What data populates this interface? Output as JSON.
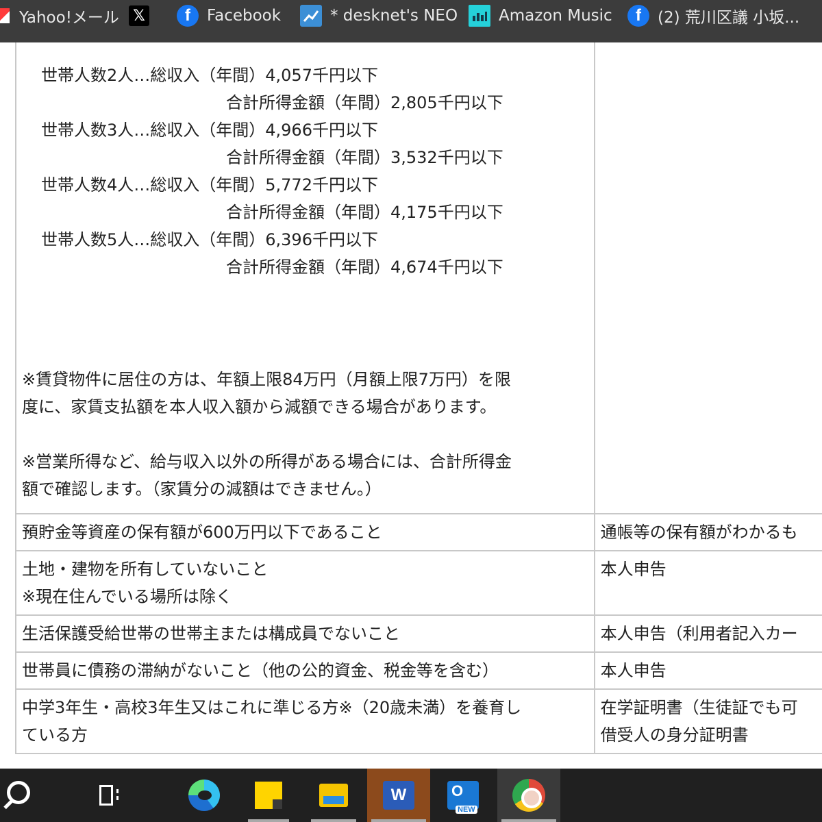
{
  "bookmarks": [
    {
      "label": "Yahoo!メール",
      "icon": "yahoo-mail-icon"
    },
    {
      "label": "",
      "icon": "x-icon",
      "glyph": "𝕏"
    },
    {
      "label": "Facebook",
      "icon": "facebook-icon",
      "glyph": "f"
    },
    {
      "label": "* desknet's NEO",
      "icon": "desknets-neo-icon"
    },
    {
      "label": "Amazon Music",
      "icon": "amazon-music-icon"
    },
    {
      "label": "(2) 荒川区議 小坂...",
      "icon": "facebook-icon",
      "glyph": "f"
    }
  ],
  "income_limits": [
    {
      "primary": "世帯人数2人…総収入（年間）4,057千円以下",
      "secondary": "合計所得金額（年間）2,805千円以下"
    },
    {
      "primary": "世帯人数3人…総収入（年間）4,966千円以下",
      "secondary": "合計所得金額（年間）3,532千円以下"
    },
    {
      "primary": "世帯人数4人…総収入（年間）5,772千円以下",
      "secondary": "合計所得金額（年間）4,175千円以下"
    },
    {
      "primary": "世帯人数5人…総収入（年間）6,396千円以下",
      "secondary": "合計所得金額（年間）4,674千円以下"
    }
  ],
  "notes": [
    [
      "※賃貸物件に居住の方は、年額上限84万円（月額上限7万円）を限",
      "度に、家賃支払額を本人収入額から減額できる場合があります。"
    ],
    [
      "※営業所得など、給与収入以外の所得がある場合には、合計所得金",
      "額で確認します。（家賃分の減額はできません。）"
    ]
  ],
  "rows": [
    {
      "condition": [
        "預貯金等資産の保有額が600万円以下であること"
      ],
      "document": [
        "通帳等の保有額がわかるも"
      ]
    },
    {
      "condition": [
        "土地・建物を所有していないこと",
        "※現在住んでいる場所は除く"
      ],
      "document": [
        "本人申告"
      ]
    },
    {
      "condition": [
        "生活保護受給世帯の世帯主または構成員でないこと"
      ],
      "document": [
        "本人申告（利用者記入カー"
      ]
    },
    {
      "condition": [
        "世帯員に債務の滞納がないこと（他の公的資金、税金等を含む）"
      ],
      "document": [
        "本人申告"
      ]
    },
    {
      "condition": [
        "中学3年生・高校3年生又はこれに準じる方※（20歳未満）を養育し",
        "ている方"
      ],
      "document": [
        "在学証明書（生徒証でも可",
        "借受人の身分証明書"
      ]
    }
  ],
  "taskbar": [
    {
      "name": "search-icon",
      "active": false
    },
    {
      "name": "task-view-icon",
      "active": false
    },
    {
      "name": "edge-icon",
      "active": false
    },
    {
      "name": "sticky-notes-icon",
      "active": false
    },
    {
      "name": "file-explorer-icon",
      "active": false
    },
    {
      "name": "word-icon",
      "active": true,
      "glyph": "W"
    },
    {
      "name": "outlook-icon",
      "active": false,
      "glyph": "O",
      "badge": "NEW"
    },
    {
      "name": "chrome-icon",
      "active": true
    }
  ]
}
